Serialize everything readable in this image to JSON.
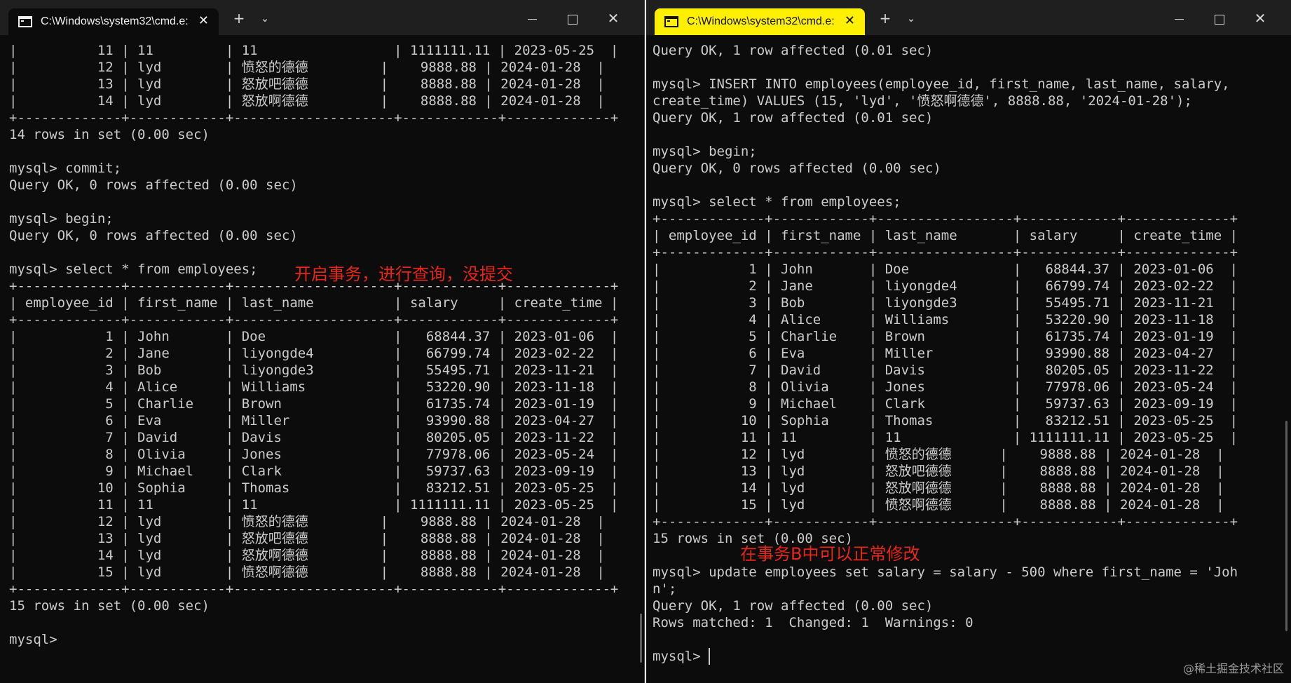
{
  "left_window": {
    "tab_title": "C:\\Windows\\system32\\cmd.e:",
    "tab_close": "✕",
    "new_tab": "+",
    "dropdown": "⌄",
    "close": "✕",
    "lines": [
      "|          11 | 11         | 11                 | 1111111.11 | 2023-05-25  |",
      "|          12 | lyd        | 愤怒的德德         |    9888.88 | 2024-01-28  |",
      "|          13 | lyd        | 怒放吧德德         |    8888.88 | 2024-01-28  |",
      "|          14 | lyd        | 怒放啊德德         |    8888.88 | 2024-01-28  |",
      "+-------------+------------+--------------------+------------+-------------+",
      "14 rows in set (0.00 sec)",
      "",
      "mysql> commit;",
      "Query OK, 0 rows affected (0.00 sec)",
      "",
      "mysql> begin;",
      "Query OK, 0 rows affected (0.00 sec)",
      "",
      "mysql> select * from employees;",
      "+-------------+------------+--------------------+------------+-------------+",
      "| employee_id | first_name | last_name          | salary     | create_time |",
      "+-------------+------------+--------------------+------------+-------------+",
      "|           1 | John       | Doe                |   68844.37 | 2023-01-06  |",
      "|           2 | Jane       | liyongde4          |   66799.74 | 2023-02-22  |",
      "|           3 | Bob        | liyongde3          |   55495.71 | 2023-11-21  |",
      "|           4 | Alice      | Williams           |   53220.90 | 2023-11-18  |",
      "|           5 | Charlie    | Brown              |   61735.74 | 2023-01-19  |",
      "|           6 | Eva        | Miller             |   93990.88 | 2023-04-27  |",
      "|           7 | David      | Davis              |   80205.05 | 2023-11-22  |",
      "|           8 | Olivia     | Jones              |   77978.06 | 2023-05-24  |",
      "|           9 | Michael    | Clark              |   59737.63 | 2023-09-19  |",
      "|          10 | Sophia     | Thomas             |   83212.51 | 2023-05-25  |",
      "|          11 | 11         | 11                 | 1111111.11 | 2023-05-25  |",
      "|          12 | lyd        | 愤怒的德德         |    9888.88 | 2024-01-28  |",
      "|          13 | lyd        | 怒放吧德德         |    8888.88 | 2024-01-28  |",
      "|          14 | lyd        | 怒放啊德德         |    8888.88 | 2024-01-28  |",
      "|          15 | lyd        | 愤怒啊德德         |    8888.88 | 2024-01-28  |",
      "+-------------+------------+--------------------+------------+-------------+",
      "15 rows in set (0.00 sec)",
      "",
      "mysql>"
    ],
    "annotation": "开启事务，进行查询，没提交"
  },
  "right_window": {
    "tab_title": "C:\\Windows\\system32\\cmd.e:",
    "tab_close": "✕",
    "new_tab": "+",
    "dropdown": "⌄",
    "close": "✕",
    "lines": [
      "Query OK, 1 row affected (0.01 sec)",
      "",
      "mysql> INSERT INTO employees(employee_id, first_name, last_name, salary,",
      "create_time) VALUES (15, 'lyd', '愤怒啊德德', 8888.88, '2024-01-28');",
      "Query OK, 1 row affected (0.01 sec)",
      "",
      "mysql> begin;",
      "Query OK, 0 rows affected (0.00 sec)",
      "",
      "mysql> select * from employees;",
      "+-------------+------------+-----------------+------------+-------------+",
      "| employee_id | first_name | last_name       | salary     | create_time |",
      "+-------------+------------+-----------------+------------+-------------+",
      "|           1 | John       | Doe             |   68844.37 | 2023-01-06  |",
      "|           2 | Jane       | liyongde4       |   66799.74 | 2023-02-22  |",
      "|           3 | Bob        | liyongde3       |   55495.71 | 2023-11-21  |",
      "|           4 | Alice      | Williams        |   53220.90 | 2023-11-18  |",
      "|           5 | Charlie    | Brown           |   61735.74 | 2023-01-19  |",
      "|           6 | Eva        | Miller          |   93990.88 | 2023-04-27  |",
      "|           7 | David      | Davis           |   80205.05 | 2023-11-22  |",
      "|           8 | Olivia     | Jones           |   77978.06 | 2023-05-24  |",
      "|           9 | Michael    | Clark           |   59737.63 | 2023-09-19  |",
      "|          10 | Sophia     | Thomas          |   83212.51 | 2023-05-25  |",
      "|          11 | 11         | 11              | 1111111.11 | 2023-05-25  |",
      "|          12 | lyd        | 愤怒的德德      |    9888.88 | 2024-01-28  |",
      "|          13 | lyd        | 怒放吧德德      |    8888.88 | 2024-01-28  |",
      "|          14 | lyd        | 怒放啊德德      |    8888.88 | 2024-01-28  |",
      "|          15 | lyd        | 愤怒啊德德      |    8888.88 | 2024-01-28  |",
      "+-------------+------------+-----------------+------------+-------------+",
      "15 rows in set (0.00 sec)",
      "",
      "mysql> update employees set salary = salary - 500 where first_name = 'Joh",
      "n';",
      "Query OK, 1 row affected (0.00 sec)",
      "Rows matched: 1  Changed: 1  Warnings: 0",
      "",
      "mysql> "
    ],
    "annotation": "在事务B中可以正常修改"
  },
  "watermark": "@稀土掘金技术社区",
  "colors": {
    "terminal_bg": "#0c0c0c",
    "terminal_text": "#cccccc",
    "active_tab": "#ffef00",
    "annotation": "#e8261a"
  }
}
